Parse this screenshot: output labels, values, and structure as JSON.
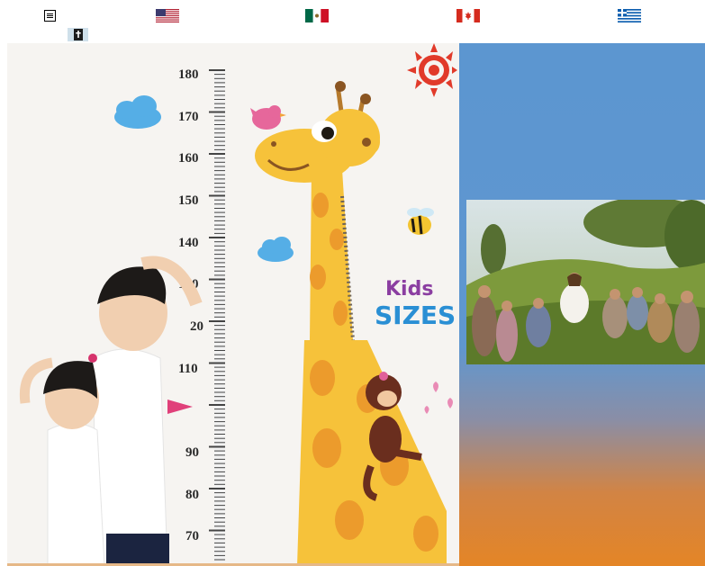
{
  "topbar": {
    "menu_icon": "hamburger-icon",
    "flags": [
      {
        "country": "United States",
        "icon": "us-flag-icon"
      },
      {
        "country": "Mexico",
        "icon": "mexico-flag-icon"
      },
      {
        "country": "Canada",
        "icon": "canada-flag-icon"
      },
      {
        "country": "Greece",
        "icon": "greece-flag-icon"
      }
    ],
    "bible_icon": "bible-icon"
  },
  "height_chart": {
    "ruler_labels": [
      "180",
      "170",
      "160",
      "150",
      "140",
      "130",
      "20",
      "110",
      "90",
      "80",
      "70"
    ],
    "kids_word": "Kids",
    "sizes_word": "SIZES"
  },
  "colors": {
    "panel_blue": "#5c96d0",
    "panel_orange": "#e48526",
    "giraffe_yellow": "#f6c23a",
    "giraffe_spot": "#ec9b2c"
  }
}
